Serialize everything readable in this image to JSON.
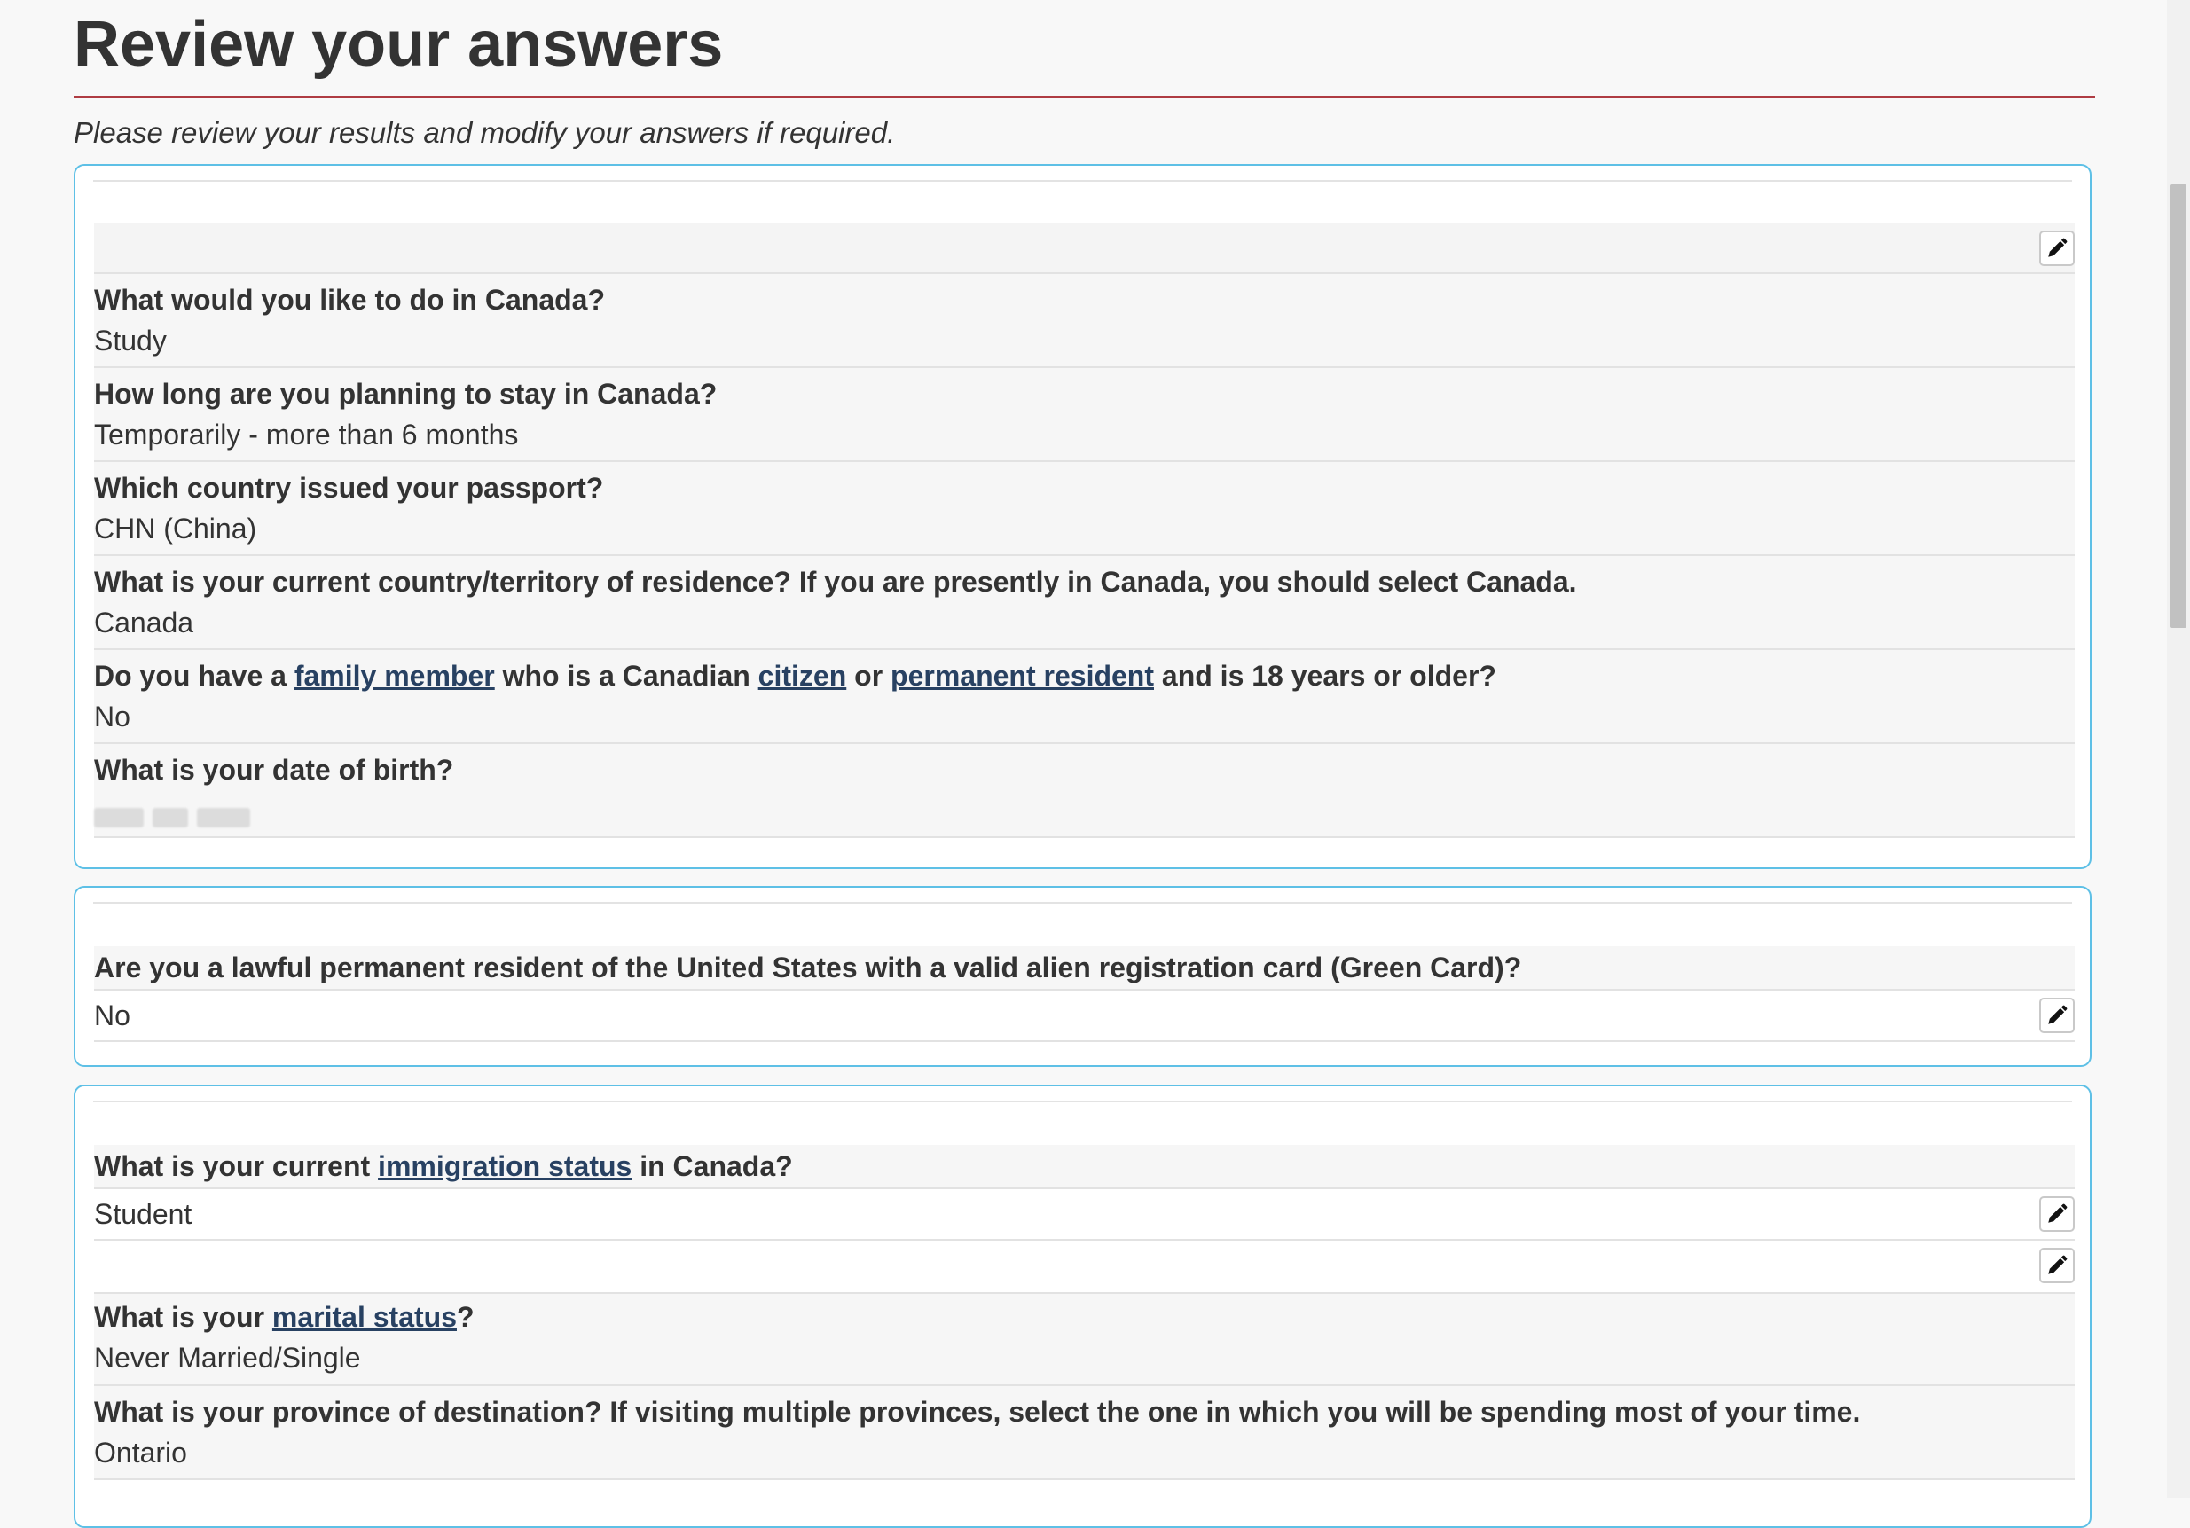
{
  "page": {
    "title": "Review your answers",
    "intro": "Please review your results and modify your answers if required."
  },
  "panel1": {
    "items": [
      {
        "question": "What would you like to do in Canada?",
        "answer": "Study"
      },
      {
        "question": "How long are you planning to stay in Canada?",
        "answer": "Temporarily - more than 6 months"
      },
      {
        "question": "Which country issued your passport?",
        "answer": "CHN (China)"
      },
      {
        "question": "What is your current country/territory of residence? If you are presently in Canada, you should select Canada.",
        "answer": "Canada"
      },
      {
        "question_parts": [
          "Do you have a ",
          "family member",
          " who is a Canadian ",
          "citizen",
          " or ",
          "permanent resident",
          " and is 18 years or older?"
        ],
        "answer": "No"
      },
      {
        "question": "What is your date of birth?",
        "answer_redacted": true
      }
    ]
  },
  "panel2": {
    "question": "Are you a lawful permanent resident of the United States with a valid alien registration card (Green Card)?",
    "answer": "No"
  },
  "panel3": {
    "immigration": {
      "question_parts": [
        "What is your current ",
        "immigration status",
        " in Canada?"
      ],
      "answer": "Student"
    },
    "marital": {
      "question_parts": [
        "What is your ",
        "marital status",
        "?"
      ],
      "answer": "Never Married/Single"
    },
    "province": {
      "question": "What is your province of destination? If visiting multiple provinces, select the one in which you will be spending most of your time.",
      "answer": "Ontario"
    }
  },
  "icons": {
    "edit": "pencil-icon"
  },
  "colors": {
    "accent_rule": "#af3c43",
    "panel_border": "#5ec0e6",
    "link": "#284162"
  }
}
